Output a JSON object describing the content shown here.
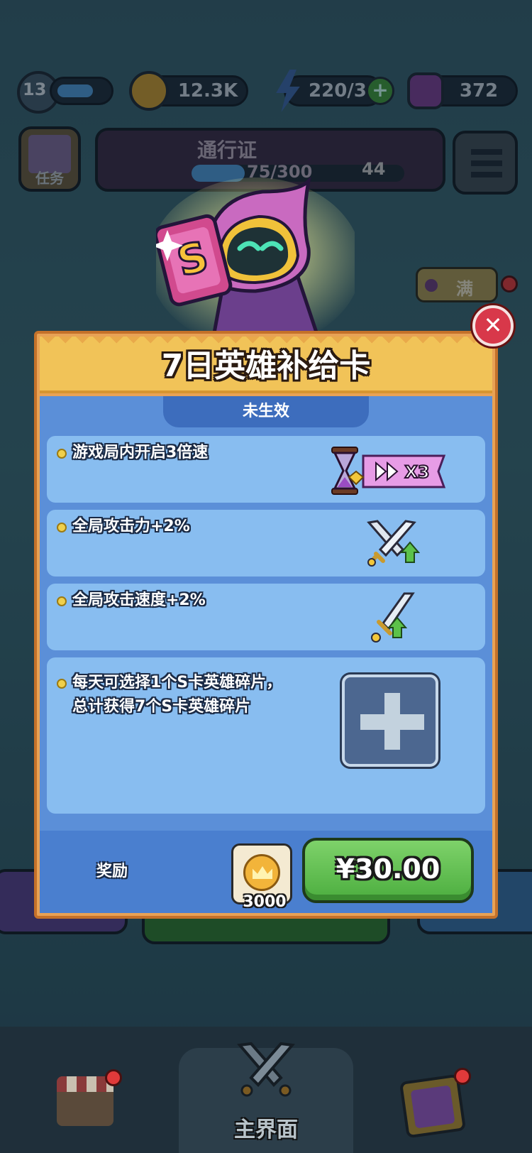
{
  "topbar": {
    "level": "13",
    "gold": "12.3K",
    "energy": "220/30",
    "gems": "372"
  },
  "quest_button_label": "任务",
  "pass": {
    "title": "通行证",
    "progress": "75/300",
    "level": "44"
  },
  "side_badge": "满",
  "modal": {
    "title": "7日英雄补给卡",
    "status": "未生效",
    "perks": [
      {
        "text": "游戏局内开启3倍速",
        "icon": "hourglass-speed-icon",
        "tag": "X3"
      },
      {
        "text": "全局攻击力+2%",
        "icon": "crossed-swords-up-icon"
      },
      {
        "text": "全局攻击速度+2%",
        "icon": "sword-up-icon"
      },
      {
        "text_line1": "每天可选择1个S卡英雄碎片，",
        "text_line2": "总计获得7个S卡英雄碎片",
        "icon": "plus-slot-icon"
      }
    ],
    "reward_label": "奖励",
    "reward_count": "3000",
    "price": "¥30.00"
  },
  "bottom_nav": {
    "center_label": "主界面"
  },
  "colors": {
    "modal_frame": "#e8a255",
    "header": "#f1c358",
    "body_blue": "#5b8fd8",
    "row_blue": "#88bdf0",
    "buy_green": "#4cae3f",
    "close_red": "#d8384a"
  }
}
